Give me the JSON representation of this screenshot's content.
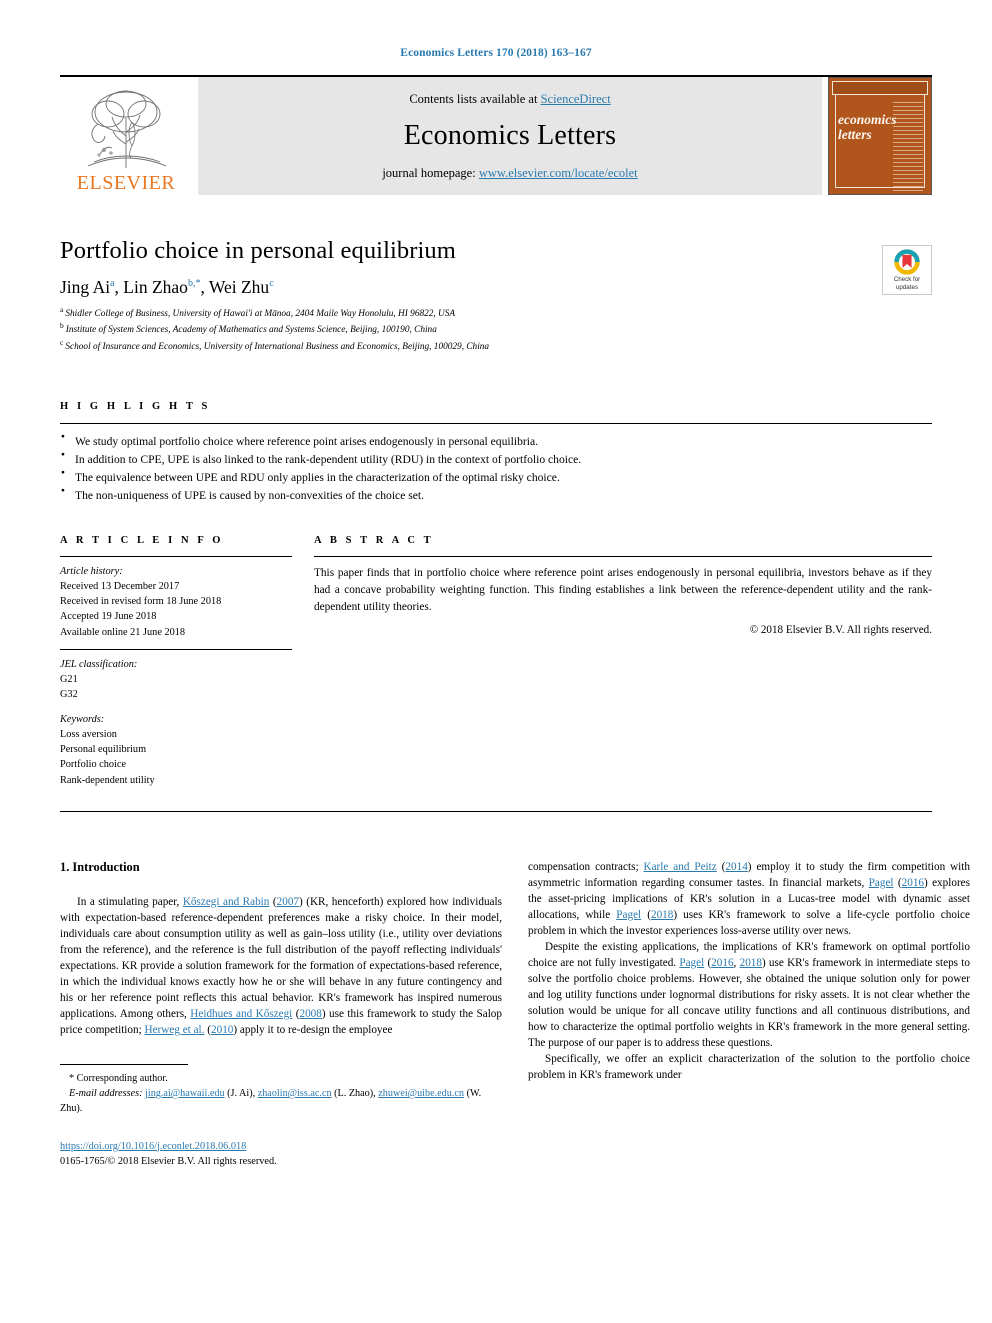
{
  "running_head": "Economics Letters 170 (2018) 163–167",
  "masthead": {
    "contents_prefix": "Contents lists available at ",
    "contents_link": "ScienceDirect",
    "journal_name": "Economics Letters",
    "homepage_prefix": "journal homepage: ",
    "homepage_link": "www.elsevier.com/locate/ecolet",
    "publisher_logo_text": "ELSEVIER",
    "cover_title_line1": "economics",
    "cover_title_line2": "letters"
  },
  "crossmark": {
    "line1": "Check for",
    "line2": "updates"
  },
  "title": "Portfolio choice in personal equilibrium",
  "authors": [
    {
      "name": "Jing Ai",
      "mark": "a",
      "sep": ", "
    },
    {
      "name": "Lin Zhao",
      "mark": "b,*",
      "sep": ", "
    },
    {
      "name": "Wei Zhu",
      "mark": "c",
      "sep": ""
    }
  ],
  "affiliations": [
    {
      "mark": "a",
      "text": "Shidler College of Business, University of Hawai'i at Mānoa, 2404 Maile Way Honolulu, HI 96822, USA"
    },
    {
      "mark": "b",
      "text": "Institute of System Sciences, Academy of Mathematics and Systems Science, Beijing, 100190, China"
    },
    {
      "mark": "c",
      "text": "School of Insurance and Economics, University of International Business and Economics, Beijing, 100029, China"
    }
  ],
  "highlights": {
    "heading": "H I G H L I G H T S",
    "items": [
      "We study optimal portfolio choice where reference point arises endogenously in personal equilibria.",
      "In addition to CPE, UPE is also linked to the rank-dependent utility (RDU) in the context of portfolio choice.",
      "The equivalence between UPE and RDU only applies in the characterization of the optimal risky choice.",
      "The non-uniqueness of UPE is caused by non-convexities of the choice set."
    ]
  },
  "article_info": {
    "heading": "A R T I C L E   I N F O",
    "history_title": "Article history:",
    "history": [
      "Received 13 December 2017",
      "Received in revised form 18 June 2018",
      "Accepted 19 June 2018",
      "Available online 21 June 2018"
    ],
    "jel_title": "JEL classification:",
    "jel": [
      "G21",
      "G32"
    ],
    "keywords_title": "Keywords:",
    "keywords": [
      "Loss aversion",
      "Personal equilibrium",
      "Portfolio choice",
      "Rank-dependent utility"
    ]
  },
  "abstract": {
    "heading": "A B S T R A C T",
    "text": "This paper finds that in portfolio choice where reference point arises endogenously in personal equilibria, investors behave as if they had a concave probability weighting function. This finding establishes a link between the reference-dependent utility and the rank-dependent utility theories.",
    "copyright": "© 2018 Elsevier B.V. All rights reserved."
  },
  "body": {
    "section_heading": "1. Introduction",
    "left_p1_a": "In a stimulating paper, ",
    "left_p1_link1": "Kőszegi and Rabin",
    "left_p1_b": " (",
    "left_p1_link2": "2007",
    "left_p1_c": ") (KR, henceforth) explored how individuals with expectation-based reference-dependent preferences make a risky choice. In their model, individuals care about consumption utility as well as gain–loss utility (i.e., utility over deviations from the reference), and the reference is the full distribution of the payoff reflecting individuals' expectations. KR provide a solution framework for the formation of expectations-based reference, in which the individual knows exactly how he or she will behave in any future contingency and his or her reference point reflects this actual behavior. KR's framework has inspired numerous applications. Among others, ",
    "left_p1_link3": "Heidhues and Kőszegi",
    "left_p1_d": " (",
    "left_p1_link4": "2008",
    "left_p1_e": ") use this framework to study the Salop price competition; ",
    "left_p1_link5": "Herweg et al.",
    "left_p1_f": " (",
    "left_p1_link6": "2010",
    "left_p1_g": ") apply it to re-design the employee",
    "right_p1_a": "compensation contracts; ",
    "right_p1_link1": "Karle and Peitz",
    "right_p1_b": " (",
    "right_p1_link2": "2014",
    "right_p1_c": ") employ it to study the firm competition with asymmetric information regarding consumer tastes. In financial markets, ",
    "right_p1_link3": "Pagel",
    "right_p1_d": " (",
    "right_p1_link4": "2016",
    "right_p1_e": ") explores the asset-pricing implications of KR's solution in a Lucas-tree model with dynamic asset allocations, while ",
    "right_p1_link5": "Pagel",
    "right_p1_f": " (",
    "right_p1_link6": "2018",
    "right_p1_g": ") uses KR's framework to solve a life-cycle portfolio choice problem in which the investor experiences loss-averse utility over news.",
    "right_p2_a": "Despite the existing applications, the implications of KR's framework on optimal portfolio choice are not fully investigated. ",
    "right_p2_link1": "Pagel",
    "right_p2_b": " (",
    "right_p2_link2": "2016",
    "right_p2_c": ", ",
    "right_p2_link3": "2018",
    "right_p2_d": ") use KR's framework in intermediate steps to solve the portfolio choice problems. However, she obtained the unique solution only for power and log utility functions under lognormal distributions for risky assets. It is not clear whether the solution would be unique for all concave utility functions and all continuous distributions, and how to characterize the optimal portfolio weights in KR's framework in the more general setting. The purpose of our paper is to address these questions.",
    "right_p3": "Specifically, we offer an explicit characterization of the solution to the portfolio choice problem in KR's framework under"
  },
  "footnote": {
    "corresponding": "* Corresponding author.",
    "email_label": "E-mail addresses:",
    "email1": "jing.ai@hawaii.edu",
    "email1_owner": " (J. Ai), ",
    "email2": "zhaolin@iss.ac.cn",
    "email2_owner": " (L. Zhao), ",
    "email3": "zhuwei@uibe.edu.cn",
    "email3_owner": " (W. Zhu)."
  },
  "doi_block": {
    "doi": "https://doi.org/10.1016/j.econlet.2018.06.018",
    "issn_line": "0165-1765/© 2018 Elsevier B.V. All rights reserved."
  },
  "colors": {
    "link": "#2a7ab0",
    "elsevier_orange": "#e87722",
    "cover_brown": "#b0561d",
    "masthead_gray": "#e6e6e6"
  }
}
